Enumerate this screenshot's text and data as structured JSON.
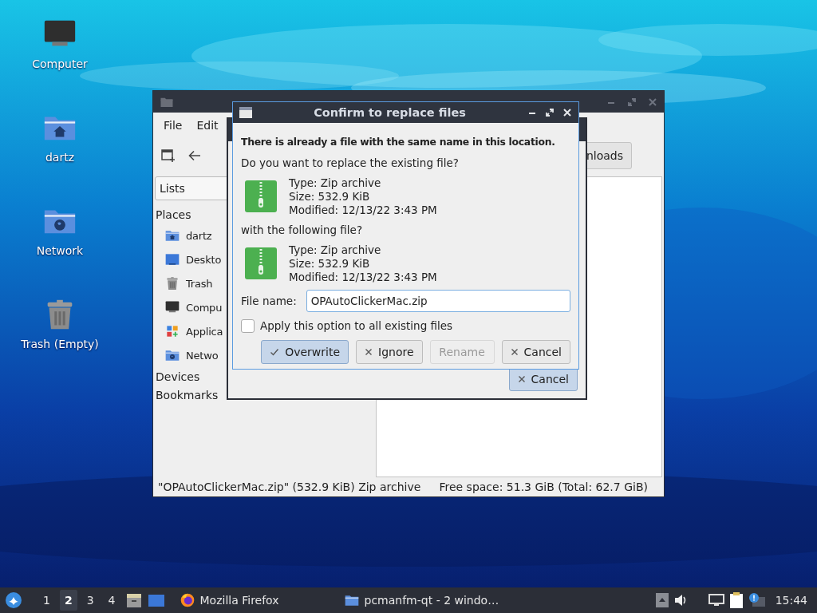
{
  "desktop_icons": [
    {
      "label": "Computer",
      "kind": "computer"
    },
    {
      "label": "dartz",
      "kind": "home"
    },
    {
      "label": "Network",
      "kind": "network"
    },
    {
      "label": "Trash (Empty)",
      "kind": "trash"
    }
  ],
  "file_manager": {
    "menu": [
      "File",
      "Edit"
    ],
    "path_button": "nloads",
    "side_pane": {
      "view_selector": "Lists",
      "sections": [
        {
          "title": "Places",
          "items": [
            {
              "label": "dartz",
              "kind": "home"
            },
            {
              "label": "Deskto",
              "kind": "desktop"
            },
            {
              "label": "Trash",
              "kind": "trash"
            },
            {
              "label": "Compu",
              "kind": "computer"
            },
            {
              "label": "Applica",
              "kind": "applications"
            },
            {
              "label": "Netwo",
              "kind": "network"
            }
          ]
        },
        {
          "title": "Devices"
        },
        {
          "title": "Bookmarks"
        }
      ]
    },
    "status_bar": {
      "selection": "\"OPAutoClickerMac.zip\" (532.9 KiB) Zip archive",
      "free_space": "Free space: 51.3 GiB (Total: 62.7 GiB)"
    }
  },
  "progress_dialog": {
    "buttons": [
      {
        "label": "Cancel",
        "focused": true
      }
    ]
  },
  "confirm_dialog": {
    "title": "Confirm to replace files",
    "heading": "There is already a file with the same name in this location.",
    "question": "Do you want to replace the existing file?",
    "existing_file": {
      "type": "Type: Zip archive",
      "size": "Size: 532.9 KiB",
      "modified": "Modified: 12/13/22 3:43 PM"
    },
    "with_text": "with the following file?",
    "new_file": {
      "type": "Type: Zip archive",
      "size": "Size: 532.9 KiB",
      "modified": "Modified: 12/13/22 3:43 PM"
    },
    "file_name": {
      "label": "File name:",
      "value": "OPAutoClickerMac.zip"
    },
    "apply_all": {
      "label": "Apply this option to all existing files",
      "checked": false
    },
    "buttons": [
      {
        "label": "Overwrite",
        "kind": "accept",
        "focused": true,
        "disabled": false
      },
      {
        "label": "Ignore",
        "kind": "reject",
        "focused": false,
        "disabled": false
      },
      {
        "label": "Rename",
        "kind": "plain",
        "focused": false,
        "disabled": true
      },
      {
        "label": "Cancel",
        "kind": "reject",
        "focused": false,
        "disabled": false
      }
    ]
  },
  "taskbar": {
    "workspaces": [
      {
        "label": "1",
        "selected": false
      },
      {
        "label": "2",
        "selected": true
      },
      {
        "label": "3",
        "selected": false
      },
      {
        "label": "4",
        "selected": false
      }
    ],
    "tasks": [
      {
        "label": "Mozilla Firefox",
        "kind": "browser"
      },
      {
        "label": "pcmanfm-qt - 2 windo…",
        "kind": "folder"
      }
    ],
    "clock": "15:44"
  }
}
